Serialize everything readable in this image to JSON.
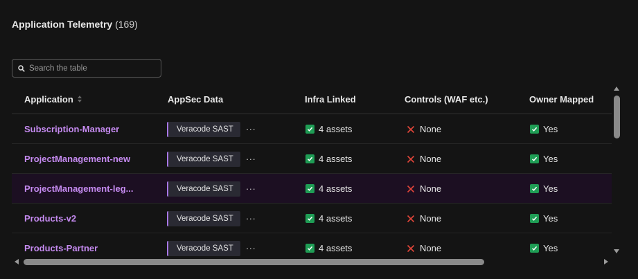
{
  "header": {
    "title": "Application Telemetry",
    "count": "(169)"
  },
  "search": {
    "placeholder": "Search the table"
  },
  "columns": {
    "application": "Application",
    "appsec": "AppSec Data",
    "infra": "Infra Linked",
    "controls": "Controls (WAF etc.)",
    "owner": "Owner Mapped"
  },
  "rows": [
    {
      "application": "Subscription-Manager",
      "appsec_tag": "Veracode SAST",
      "more": "···",
      "infra": "4 assets",
      "controls": "None",
      "owner": "Yes"
    },
    {
      "application": "ProjectManagement-new",
      "appsec_tag": "Veracode SAST",
      "more": "···",
      "infra": "4 assets",
      "controls": "None",
      "owner": "Yes"
    },
    {
      "application": "ProjectManagement-leg...",
      "appsec_tag": "Veracode SAST",
      "more": "···",
      "infra": "4 assets",
      "controls": "None",
      "owner": "Yes"
    },
    {
      "application": "Products-v2",
      "appsec_tag": "Veracode SAST",
      "more": "···",
      "infra": "4 assets",
      "controls": "None",
      "owner": "Yes"
    },
    {
      "application": "Products-Partner",
      "appsec_tag": "Veracode SAST",
      "more": "···",
      "infra": "4 assets",
      "controls": "None",
      "owner": "Yes"
    }
  ],
  "colors": {
    "accent": "#c58af0",
    "success": "#1f9d55",
    "danger": "#e0453a",
    "highlight_row": "#1c0f22"
  }
}
